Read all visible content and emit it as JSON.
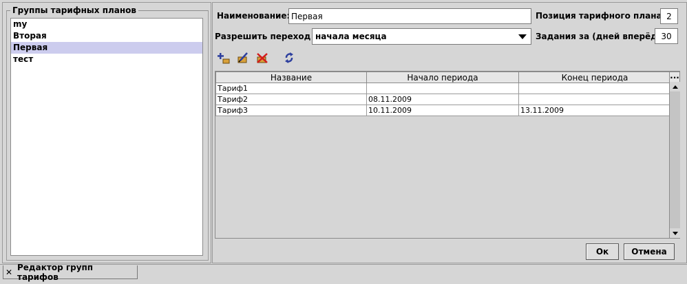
{
  "groups": {
    "title": "Группы тарифных планов",
    "items": [
      "my",
      "Вторая",
      "Первая",
      "тест"
    ],
    "selected_index": 2
  },
  "form": {
    "name_label": "Наименование:",
    "name_value": "Первая",
    "position_label": "Позиция тарифного плана:",
    "position_value": "2",
    "transition_label": "Разрешить переход с",
    "transition_value": "начала месяца",
    "tasks_label": "Задания за (дней вперёд):",
    "tasks_value": "30"
  },
  "toolbar": {
    "icons": [
      "add-tariff-icon",
      "edit-tariff-icon",
      "delete-tariff-icon",
      "refresh-icon"
    ]
  },
  "table": {
    "columns": [
      "Название",
      "Начало периода",
      "Конец периода"
    ],
    "corner_label": "...",
    "rows": [
      [
        "Тариф1",
        "",
        ""
      ],
      [
        "Тариф2",
        "08.11.2009",
        ""
      ],
      [
        "Тариф3",
        "10.11.2009",
        "13.11.2009"
      ]
    ]
  },
  "buttons": {
    "ok": "Ок",
    "cancel": "Отмена"
  },
  "tab": {
    "close": "✕",
    "label": "Редактор групп тарифов"
  },
  "colors": {
    "background": "#d6d6d6",
    "selected_row": "#ccccee"
  }
}
